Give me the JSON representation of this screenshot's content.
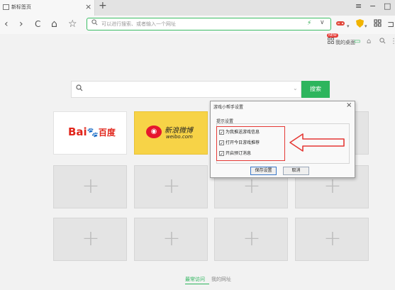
{
  "tab": {
    "title": "新标签页",
    "close": "×",
    "new": "+"
  },
  "window": {
    "menu": "≡",
    "minimize": "−",
    "maximize": "□"
  },
  "toolbar": {
    "back": "‹",
    "forward": "›",
    "reload": "C",
    "home": "⌂",
    "star": "☆",
    "address_placeholder": "可以进行搜索、或者输入一个网址",
    "bolt": "⚡",
    "dropdown": "∨"
  },
  "subbar": {
    "new_badge": "NEW",
    "desk_label": "我的桌面"
  },
  "search": {
    "button": "搜索",
    "dropdown": "⌄"
  },
  "tiles": {
    "baidu": {
      "bai": "Bai",
      "paw": "🐾",
      "du": "百度"
    },
    "weibo": {
      "cn": "新浪微博",
      "en": "weibo.com",
      "eye": "◉"
    },
    "plus": "+"
  },
  "dialog": {
    "title": "游戏小帮手设置",
    "close": "×",
    "section": "提示设置",
    "options": [
      {
        "label": "为我推送游戏信息",
        "checked": true
      },
      {
        "label": "打开今日游戏推荐",
        "checked": true
      },
      {
        "label": "开启预订消息",
        "checked": true
      }
    ],
    "save": "保存设置",
    "cancel": "取消"
  },
  "bottom_tabs": {
    "frequent": "最常访问",
    "my_sites": "我的网址"
  },
  "colors": {
    "accent": "#2db55d",
    "highlight": "#e53935"
  }
}
